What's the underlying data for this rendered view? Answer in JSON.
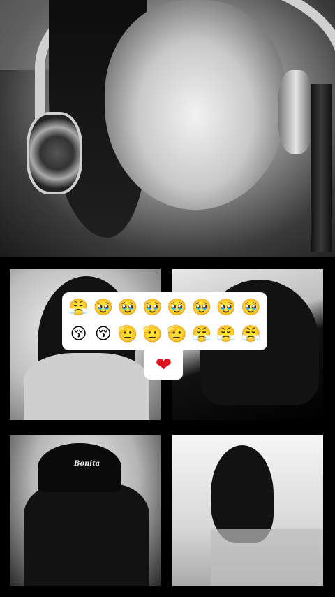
{
  "tiles": {
    "t3_cap_text": "Bonita"
  },
  "reactions": {
    "row1": [
      "😤",
      "🥹",
      "🥹",
      "🥹",
      "🥹",
      "🥹",
      "🥹",
      "🥹"
    ],
    "row2": [
      "😚",
      "😚",
      "🫡",
      "🫡",
      "🫡",
      "😤",
      "😤",
      "😤"
    ],
    "heart": "❤"
  },
  "colors": {
    "heart": "#e0141e",
    "panel_bg": "#ffffff",
    "page_bg": "#000000"
  }
}
